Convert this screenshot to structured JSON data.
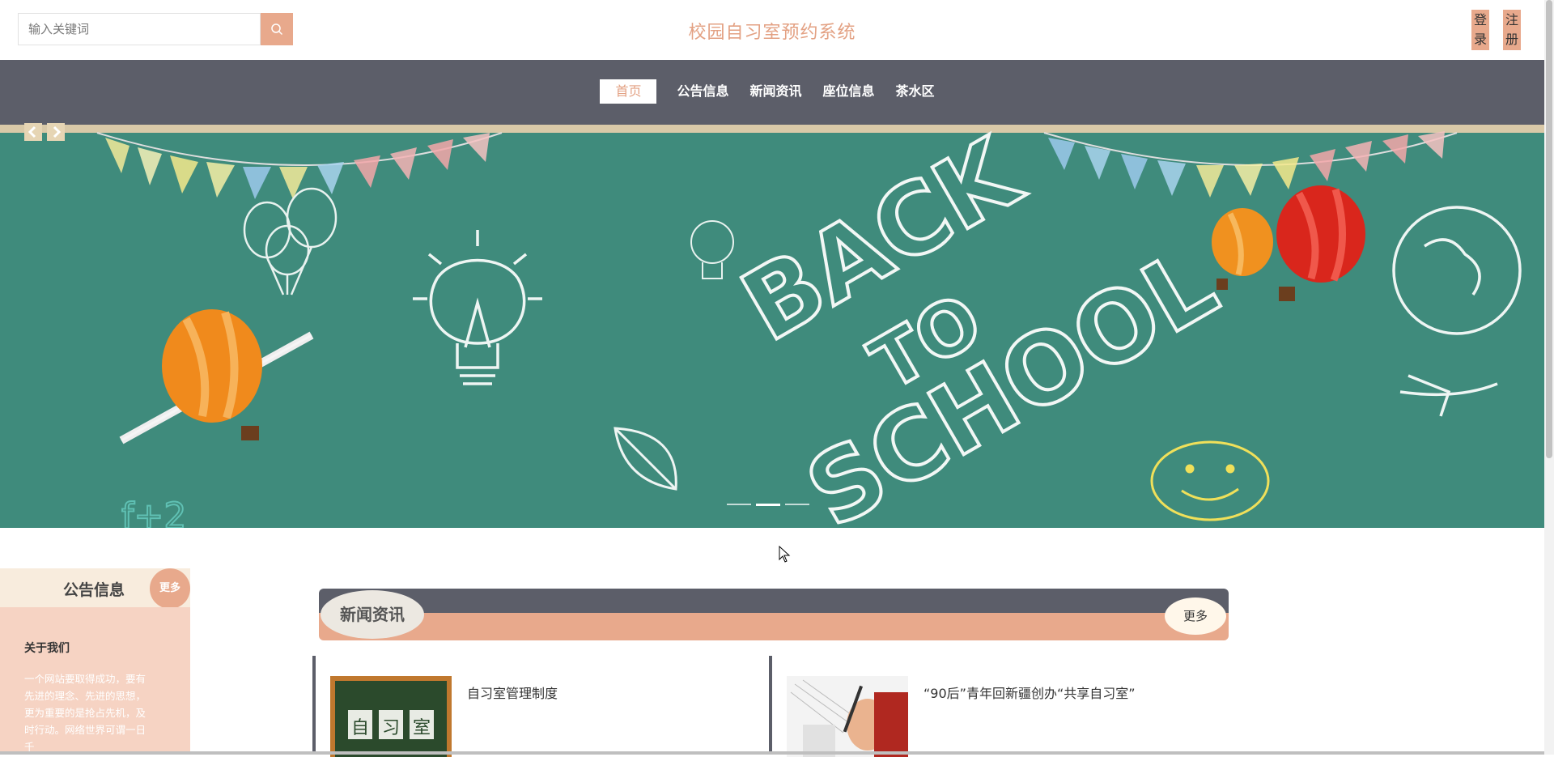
{
  "header": {
    "search_placeholder": "输入关键词",
    "site_title": "校园自习室预约系统",
    "login_label": "登录",
    "register_label": "注册"
  },
  "nav": {
    "items": [
      {
        "label": "首页",
        "active": true
      },
      {
        "label": "公告信息"
      },
      {
        "label": "新闻资讯"
      },
      {
        "label": "座位信息"
      },
      {
        "label": "茶水区"
      }
    ]
  },
  "banner": {
    "slide_count": 3,
    "active_slide": 2
  },
  "notice": {
    "title": "公告信息",
    "more_label": "更多",
    "item_title": "关于我们",
    "item_text": "一个网站要取得成功，要有先进的理念、先进的思想，更为重要的是抢占先机，及时行动。网络世界可谓一日千"
  },
  "news": {
    "title": "新闻资讯",
    "more_label": "更多",
    "items": [
      {
        "title": "自习室管理制度",
        "thumb_text": "自习室"
      },
      {
        "title": "“90后”青年回新疆创办“共享自习室”"
      }
    ]
  },
  "colors": {
    "accent": "#e8a98c",
    "nav_bg": "#5c5e69",
    "title": "#e3a183",
    "chalkboard": "#3f8b7c"
  }
}
